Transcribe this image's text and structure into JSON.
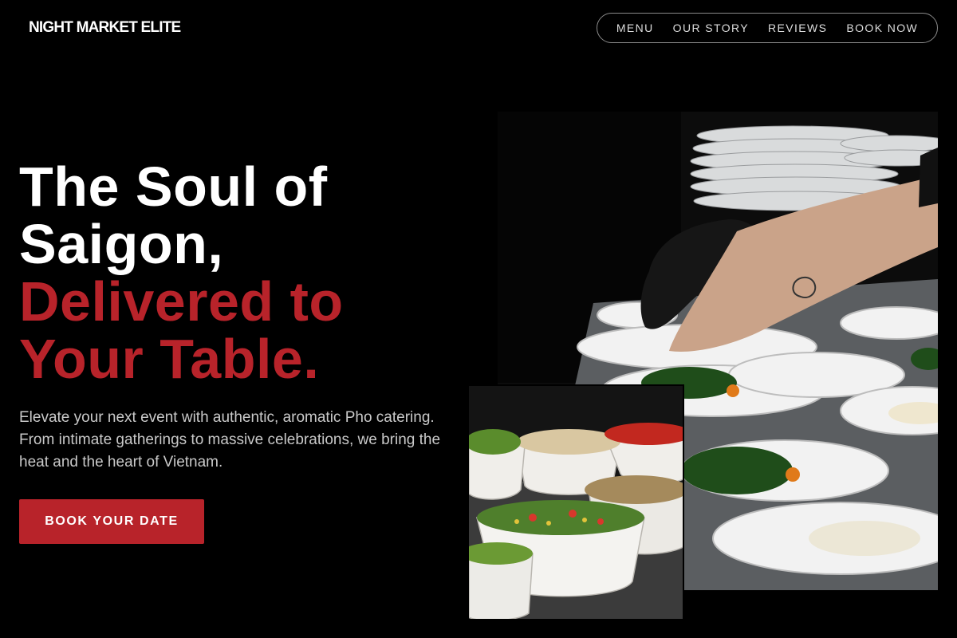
{
  "brand": {
    "name": "NIGHT MARKET ELITE"
  },
  "nav": {
    "items": [
      {
        "label": "MENU"
      },
      {
        "label": "OUR STORY"
      },
      {
        "label": "REVIEWS"
      },
      {
        "label": "BOOK NOW"
      }
    ]
  },
  "hero": {
    "title_line_1": "The Soul of",
    "title_line_2": "Saigon,",
    "title_accent_line_1": "Delivered to",
    "title_accent_line_2": "Your Table.",
    "description": "Elevate your next event with authentic, aromatic Pho catering. From intimate gatherings to massive celebrations, we bring the heat and the heart of Vietnam.",
    "cta_label": "BOOK YOUR DATE"
  },
  "colors": {
    "background": "#000000",
    "accent": "#b8232a",
    "text_primary": "#ffffff",
    "text_secondary": "#c9c9c9"
  }
}
